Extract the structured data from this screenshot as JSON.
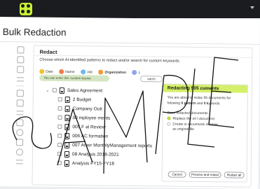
{
  "app": {
    "page_title": "Bulk Redaction",
    "accent": "#c8f035",
    "topbar_color": "#1b1c20"
  },
  "rail": {
    "icons": [
      "document-icon",
      "document-icon",
      "document-icon",
      "list-icon",
      "document-icon",
      "document-icon",
      "list-icon",
      "document-icon",
      "gear-icon",
      "document-icon",
      "help-icon",
      "arrow-right-icon"
    ]
  },
  "redact": {
    "title": "Redact",
    "subtitle": "Choose which AI-identified patterns to redact and/or search for custom keywords",
    "chips": [
      {
        "label": "Date",
        "color": "#f2c230"
      },
      {
        "label": "Name",
        "color": "#f07b4a"
      },
      {
        "label": "Job",
        "color": "#6fb6ef"
      },
      {
        "label": "Organization",
        "color": "#f29a3a"
      },
      {
        "label": "L",
        "color": "#8da7e8"
      }
    ],
    "hint": "You can enter 30+ custom keywo",
    "search_button": "earch"
  },
  "files": [
    {
      "name": "Sales Agreement",
      "expanded": true
    },
    {
      "name": "2 Budget"
    },
    {
      "name": "Company Outi"
    },
    {
      "name": "00 mployee ments"
    },
    {
      "name": "005 F al Review"
    },
    {
      "name": "006 AC formation"
    },
    {
      "name": "007 Amer MonthlyManagement reports"
    },
    {
      "name": "08 Analysis 2018-2021"
    },
    {
      "name": "Analysis FY15-FY18"
    }
  ],
  "panel": {
    "header": "Redacting 505 cuments",
    "line1": "You are about to redac 05 documents for",
    "line2_a": "fo",
    "line2_b": "lowing ",
    "line2_c": "0 pattern",
    "line2_d": " and ",
    "line2_e": "0 k",
    "line2_f": "ywords",
    "save_label": "Save redacted documents",
    "option1": "Replace the ori    l document",
    "option2": "Create     w documents in same",
    "option2_b": "    as original file",
    "cancel": "Cancel",
    "preview": "Preview and redact",
    "redact_all": "Redact all"
  },
  "watermark": "SAMPLE"
}
